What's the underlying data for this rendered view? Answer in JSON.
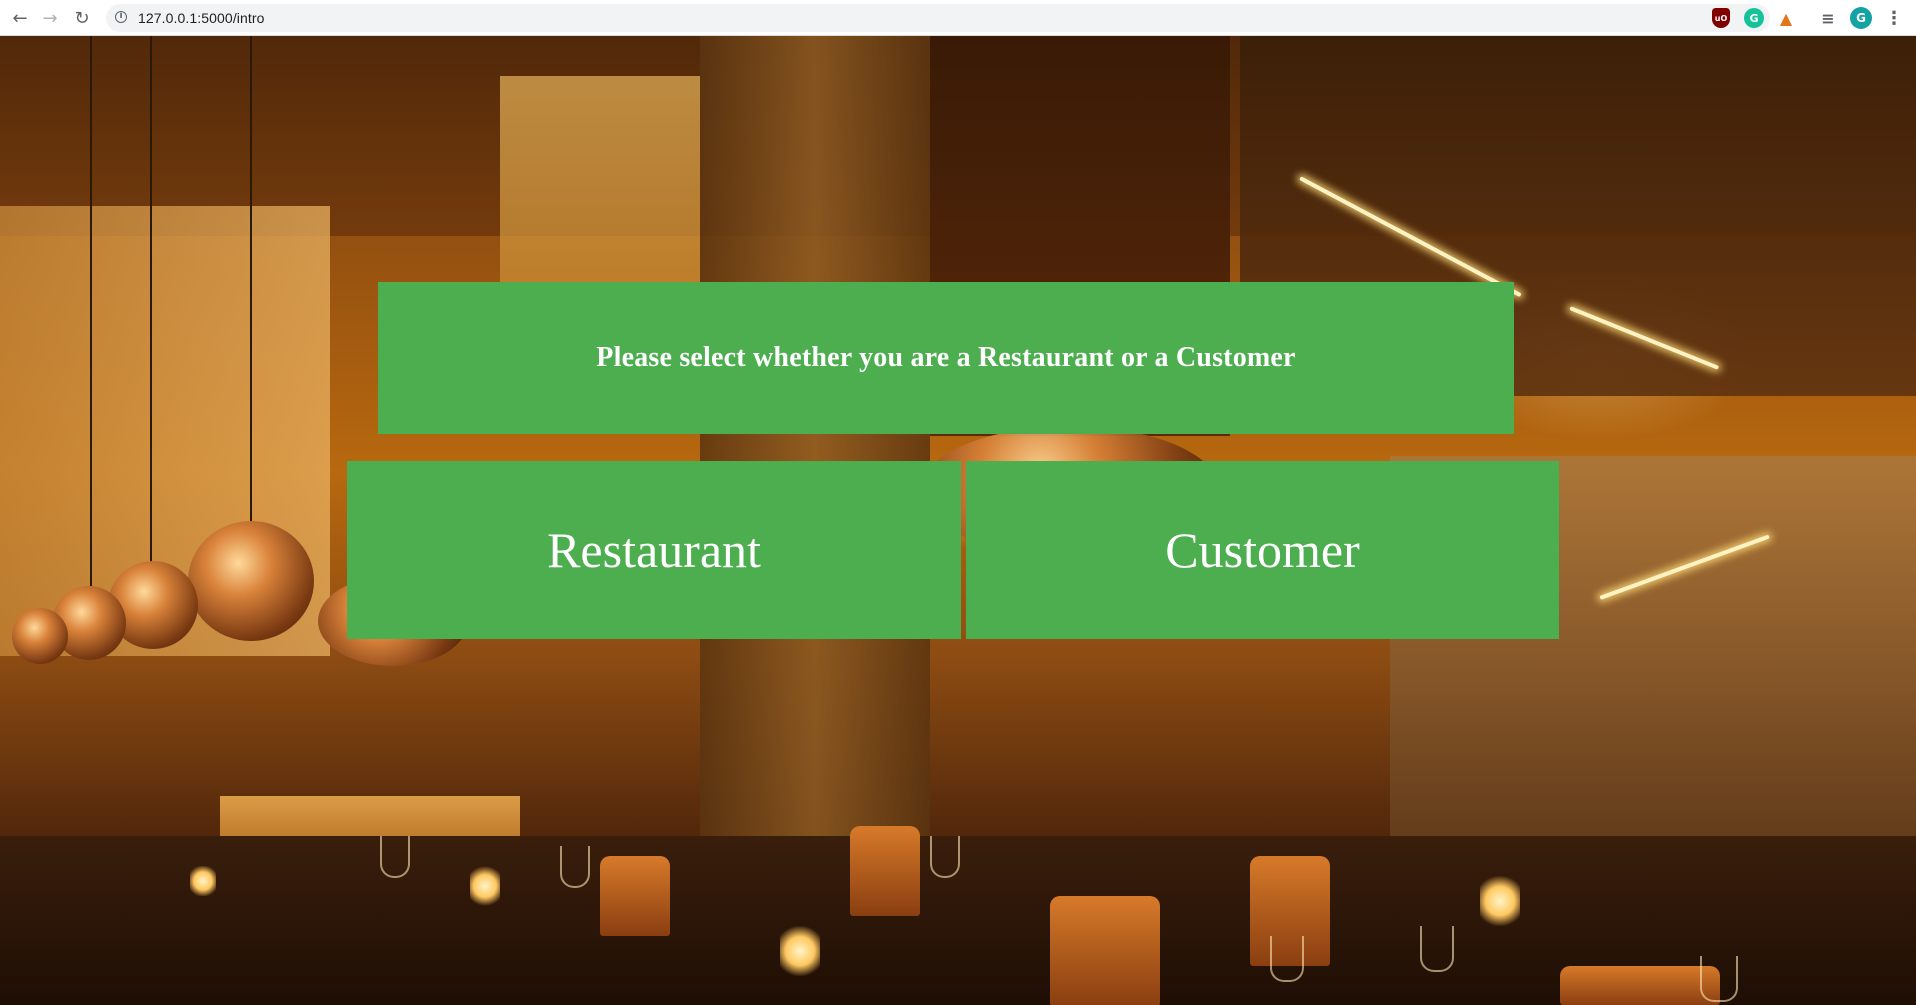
{
  "browser": {
    "url": "127.0.0.1:5000/intro",
    "profile_initial": "G"
  },
  "prompt": {
    "text": "Please select whether you are a Restaurant or a Customer"
  },
  "choices": {
    "restaurant_label": "Restaurant",
    "customer_label": "Customer"
  },
  "colors": {
    "button_green": "#4cae4f",
    "button_text": "#ffffff"
  },
  "icons": {
    "nav": [
      "back-arrow-icon",
      "forward-arrow-icon",
      "reload-icon"
    ],
    "omnibox": [
      "info-icon",
      "bookmark-star-icon"
    ],
    "extensions": [
      "ublock-icon",
      "grammarly-icon",
      "metamask-fox-icon",
      "reading-list-icon",
      "profile-avatar",
      "menu-kebab-icon"
    ]
  }
}
